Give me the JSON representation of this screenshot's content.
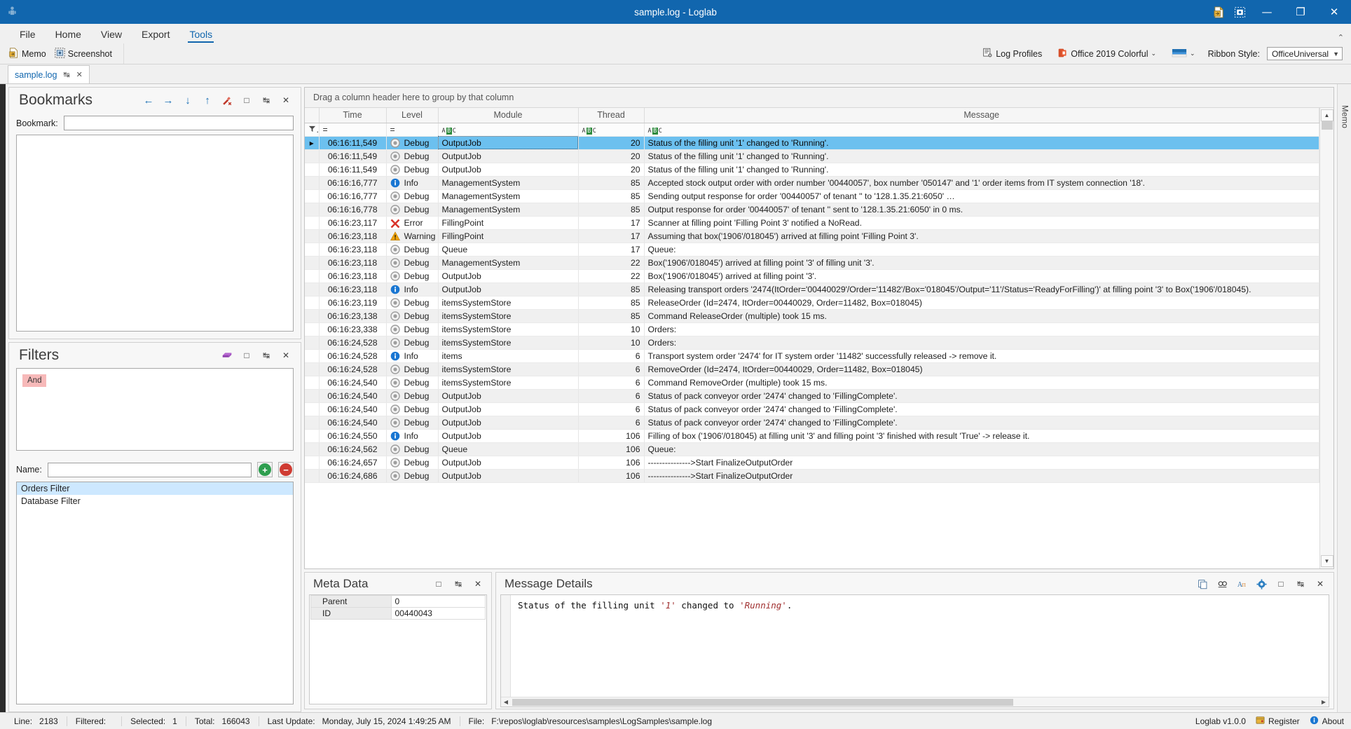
{
  "window": {
    "title": "sample.log - Loglab",
    "app_icon": "app-logo-icon",
    "quick_access": [
      "memo-icon",
      "screenshot-icon"
    ],
    "minimize": "—",
    "maximize": "❐",
    "close": "✕"
  },
  "ribbon": {
    "tabs": [
      {
        "label": "File",
        "active": false
      },
      {
        "label": "Home",
        "active": false
      },
      {
        "label": "View",
        "active": false
      },
      {
        "label": "Export",
        "active": false
      },
      {
        "label": "Tools",
        "active": true
      }
    ],
    "collapse_caret": "⌃",
    "items": [
      {
        "label": "Memo",
        "icon": "memo-icon"
      },
      {
        "label": "Screenshot",
        "icon": "screenshot-icon"
      }
    ],
    "right": {
      "log_profiles_label": "Log Profiles",
      "theme_label": "Office 2019 Colorful",
      "ribbon_style_label": "Ribbon Style:",
      "ribbon_style_value": "OfficeUniversal",
      "caret": "⌄"
    }
  },
  "doc_tabs": [
    {
      "label": "sample.log",
      "pin": "↹",
      "close": "✕",
      "active": true
    }
  ],
  "memo_edge_label": "Memo",
  "bookmarks": {
    "title": "Bookmarks",
    "tools": [
      {
        "name": "back-arrow-icon",
        "glyph": "←"
      },
      {
        "name": "forward-arrow-icon",
        "glyph": "→"
      },
      {
        "name": "down-arrow-icon",
        "glyph": "↓"
      },
      {
        "name": "up-arrow-icon",
        "glyph": "↑"
      },
      {
        "name": "clear-bookmarks-icon",
        "glyph": "✗"
      },
      {
        "name": "maximize-panel-icon",
        "glyph": "□"
      },
      {
        "name": "pin-panel-icon",
        "glyph": "↹"
      },
      {
        "name": "close-panel-icon",
        "glyph": "✕"
      }
    ],
    "field_label": "Bookmark:",
    "field_value": "",
    "field_placeholder": ""
  },
  "filters": {
    "title": "Filters",
    "tools": [
      {
        "name": "filter-block-icon",
        "glyph": "▰"
      },
      {
        "name": "maximize-panel-icon",
        "glyph": "□"
      },
      {
        "name": "pin-panel-icon",
        "glyph": "↹"
      },
      {
        "name": "close-panel-icon",
        "glyph": "✕"
      }
    ],
    "condition_chip": "And",
    "name_label": "Name:",
    "name_value": "",
    "add_button": "+",
    "remove_button": "−",
    "saved_filters": [
      {
        "label": "Orders Filter",
        "selected": true
      },
      {
        "label": "Database Filter",
        "selected": false
      }
    ]
  },
  "grid": {
    "group_hint": "Drag a column header here to group by that column",
    "columns": [
      "Time",
      "Level",
      "Module",
      "Thread",
      "Message"
    ],
    "filter_row": {
      "funnel_icon": "funnel-icon",
      "time_op": "=",
      "level_op": "=",
      "module_op": "abc-filter-icon",
      "thread_op": "abc-filter-icon",
      "message_op": "abc-filter-icon"
    },
    "scroll": {
      "up": "▲",
      "down": "▼",
      "thumb": "—"
    },
    "rows": [
      {
        "time": "06:16:11,549",
        "level": "Debug",
        "module": "OutputJob",
        "thread": "20",
        "message": "Status of the filling unit '1' changed to 'Running'.",
        "selected": true
      },
      {
        "time": "06:16:11,549",
        "level": "Debug",
        "module": "OutputJob",
        "thread": "20",
        "message": "Status of the filling unit '1' changed to 'Running'."
      },
      {
        "time": "06:16:11,549",
        "level": "Debug",
        "module": "OutputJob",
        "thread": "20",
        "message": "Status of the filling unit '1' changed to 'Running'."
      },
      {
        "time": "06:16:16,777",
        "level": "Info",
        "module": "ManagementSystem",
        "thread": "85",
        "message": "Accepted stock output order with order number '00440057', box number '050147' and '1' order items from IT system connection '18'."
      },
      {
        "time": "06:16:16,777",
        "level": "Debug",
        "module": "ManagementSystem",
        "thread": "85",
        "message": "Sending output response for order '00440057' of tenant '' to '128.1.35.21:6050' …"
      },
      {
        "time": "06:16:16,778",
        "level": "Debug",
        "module": "ManagementSystem",
        "thread": "85",
        "message": "Output response for order '00440057' of tenant '' sent to '128.1.35.21:6050' in 0 ms."
      },
      {
        "time": "06:16:23,117",
        "level": "Error",
        "module": "FillingPoint",
        "thread": "17",
        "message": "Scanner at filling point 'Filling Point 3' notified a NoRead."
      },
      {
        "time": "06:16:23,118",
        "level": "Warning",
        "module": "FillingPoint",
        "thread": "17",
        "message": "Assuming that box('1906'/018045') arrived at filling point 'Filling Point 3'."
      },
      {
        "time": "06:16:23,118",
        "level": "Debug",
        "module": "Queue",
        "thread": "17",
        "message": "Queue:"
      },
      {
        "time": "06:16:23,118",
        "level": "Debug",
        "module": "ManagementSystem",
        "thread": "22",
        "message": "Box('1906'/018045') arrived at filling point '3' of filling unit '3'."
      },
      {
        "time": "06:16:23,118",
        "level": "Debug",
        "module": "OutputJob",
        "thread": "22",
        "message": "Box('1906'/018045') arrived at filling point '3'."
      },
      {
        "time": "06:16:23,118",
        "level": "Info",
        "module": "OutputJob",
        "thread": "85",
        "message": "Releasing transport orders '2474(ItOrder='00440029'/Order='11482'/Box='018045'/Output='11'/Status='ReadyForFilling')' at filling point '3' to Box('1906'/018045)."
      },
      {
        "time": "06:16:23,119",
        "level": "Debug",
        "module": "itemsSystemStore",
        "thread": "85",
        "message": "ReleaseOrder (Id=2474, ItOrder=00440029, Order=11482, Box=018045)"
      },
      {
        "time": "06:16:23,138",
        "level": "Debug",
        "module": "itemsSystemStore",
        "thread": "85",
        "message": "Command ReleaseOrder (multiple) took 15 ms."
      },
      {
        "time": "06:16:23,338",
        "level": "Debug",
        "module": "itemsSystemStore",
        "thread": "10",
        "message": "Orders:"
      },
      {
        "time": "06:16:24,528",
        "level": "Debug",
        "module": "itemsSystemStore",
        "thread": "10",
        "message": "Orders:"
      },
      {
        "time": "06:16:24,528",
        "level": "Info",
        "module": "items",
        "thread": "6",
        "message": "Transport system order '2474' for IT system order '11482' successfully released -> remove it."
      },
      {
        "time": "06:16:24,528",
        "level": "Debug",
        "module": "itemsSystemStore",
        "thread": "6",
        "message": "RemoveOrder (Id=2474, ItOrder=00440029, Order=11482, Box=018045)"
      },
      {
        "time": "06:16:24,540",
        "level": "Debug",
        "module": "itemsSystemStore",
        "thread": "6",
        "message": "Command RemoveOrder (multiple) took 15 ms."
      },
      {
        "time": "06:16:24,540",
        "level": "Debug",
        "module": "OutputJob",
        "thread": "6",
        "message": "Status of pack conveyor order '2474' changed to 'FillingComplete'."
      },
      {
        "time": "06:16:24,540",
        "level": "Debug",
        "module": "OutputJob",
        "thread": "6",
        "message": "Status of pack conveyor order '2474' changed to 'FillingComplete'."
      },
      {
        "time": "06:16:24,540",
        "level": "Debug",
        "module": "OutputJob",
        "thread": "6",
        "message": "Status of pack conveyor order '2474' changed to 'FillingComplete'."
      },
      {
        "time": "06:16:24,550",
        "level": "Info",
        "module": "OutputJob",
        "thread": "106",
        "message": "Filling of box ('1906'/018045) at filling unit '3' and filling point '3' finished with result 'True' -> release it."
      },
      {
        "time": "06:16:24,562",
        "level": "Debug",
        "module": "Queue",
        "thread": "106",
        "message": "Queue:"
      },
      {
        "time": "06:16:24,657",
        "level": "Debug",
        "module": "OutputJob",
        "thread": "106",
        "message": "--------------->Start FinalizeOutputOrder"
      },
      {
        "time": "06:16:24,686",
        "level": "Debug",
        "module": "OutputJob",
        "thread": "106",
        "message": "--------------->Start FinalizeOutputOrder"
      }
    ]
  },
  "meta_data": {
    "title": "Meta Data",
    "tools": [
      {
        "name": "maximize-panel-icon",
        "glyph": "□"
      },
      {
        "name": "pin-panel-icon",
        "glyph": "↹"
      },
      {
        "name": "close-panel-icon",
        "glyph": "✕"
      }
    ],
    "rows": [
      {
        "key": "Parent",
        "value": "0"
      },
      {
        "key": "ID",
        "value": "00440043"
      }
    ]
  },
  "message_details": {
    "title": "Message Details",
    "tools": [
      {
        "name": "copy-icon",
        "glyph": "❐"
      },
      {
        "name": "find-icon",
        "glyph": "⚲"
      },
      {
        "name": "font-icon",
        "glyph": "A"
      },
      {
        "name": "settings-gear-icon",
        "glyph": "⚙"
      },
      {
        "name": "maximize-panel-icon",
        "glyph": "□"
      },
      {
        "name": "pin-panel-icon",
        "glyph": "↹"
      },
      {
        "name": "close-panel-icon",
        "glyph": "✕"
      }
    ],
    "text_prefix": "Status of the filling unit ",
    "text_quoted1": "'1'",
    "text_middle": " changed to ",
    "text_quoted2": "'Running'",
    "text_suffix": "."
  },
  "statusbar": {
    "line_label": "Line:",
    "line_value": "2183",
    "filtered_label": "Filtered:",
    "filtered_value": "",
    "selected_label": "Selected:",
    "selected_value": "1",
    "total_label": "Total:",
    "total_value": "166043",
    "last_update_label": "Last Update:",
    "last_update_value": "Monday, July 15, 2024 1:49:25 AM",
    "file_label": "File:",
    "file_value": "F:\\repos\\loglab\\resources\\samples\\LogSamples\\sample.log",
    "version": "Loglab v1.0.0",
    "register_label": "Register",
    "about_label": "About"
  },
  "colors": {
    "accent": "#1166ae",
    "selection": "#6cc0ef",
    "error": "#d9342b",
    "warning": "#f0a30a",
    "info": "#1976d2",
    "debug": "#9e9e9e",
    "chip": "#f7b9b9"
  }
}
